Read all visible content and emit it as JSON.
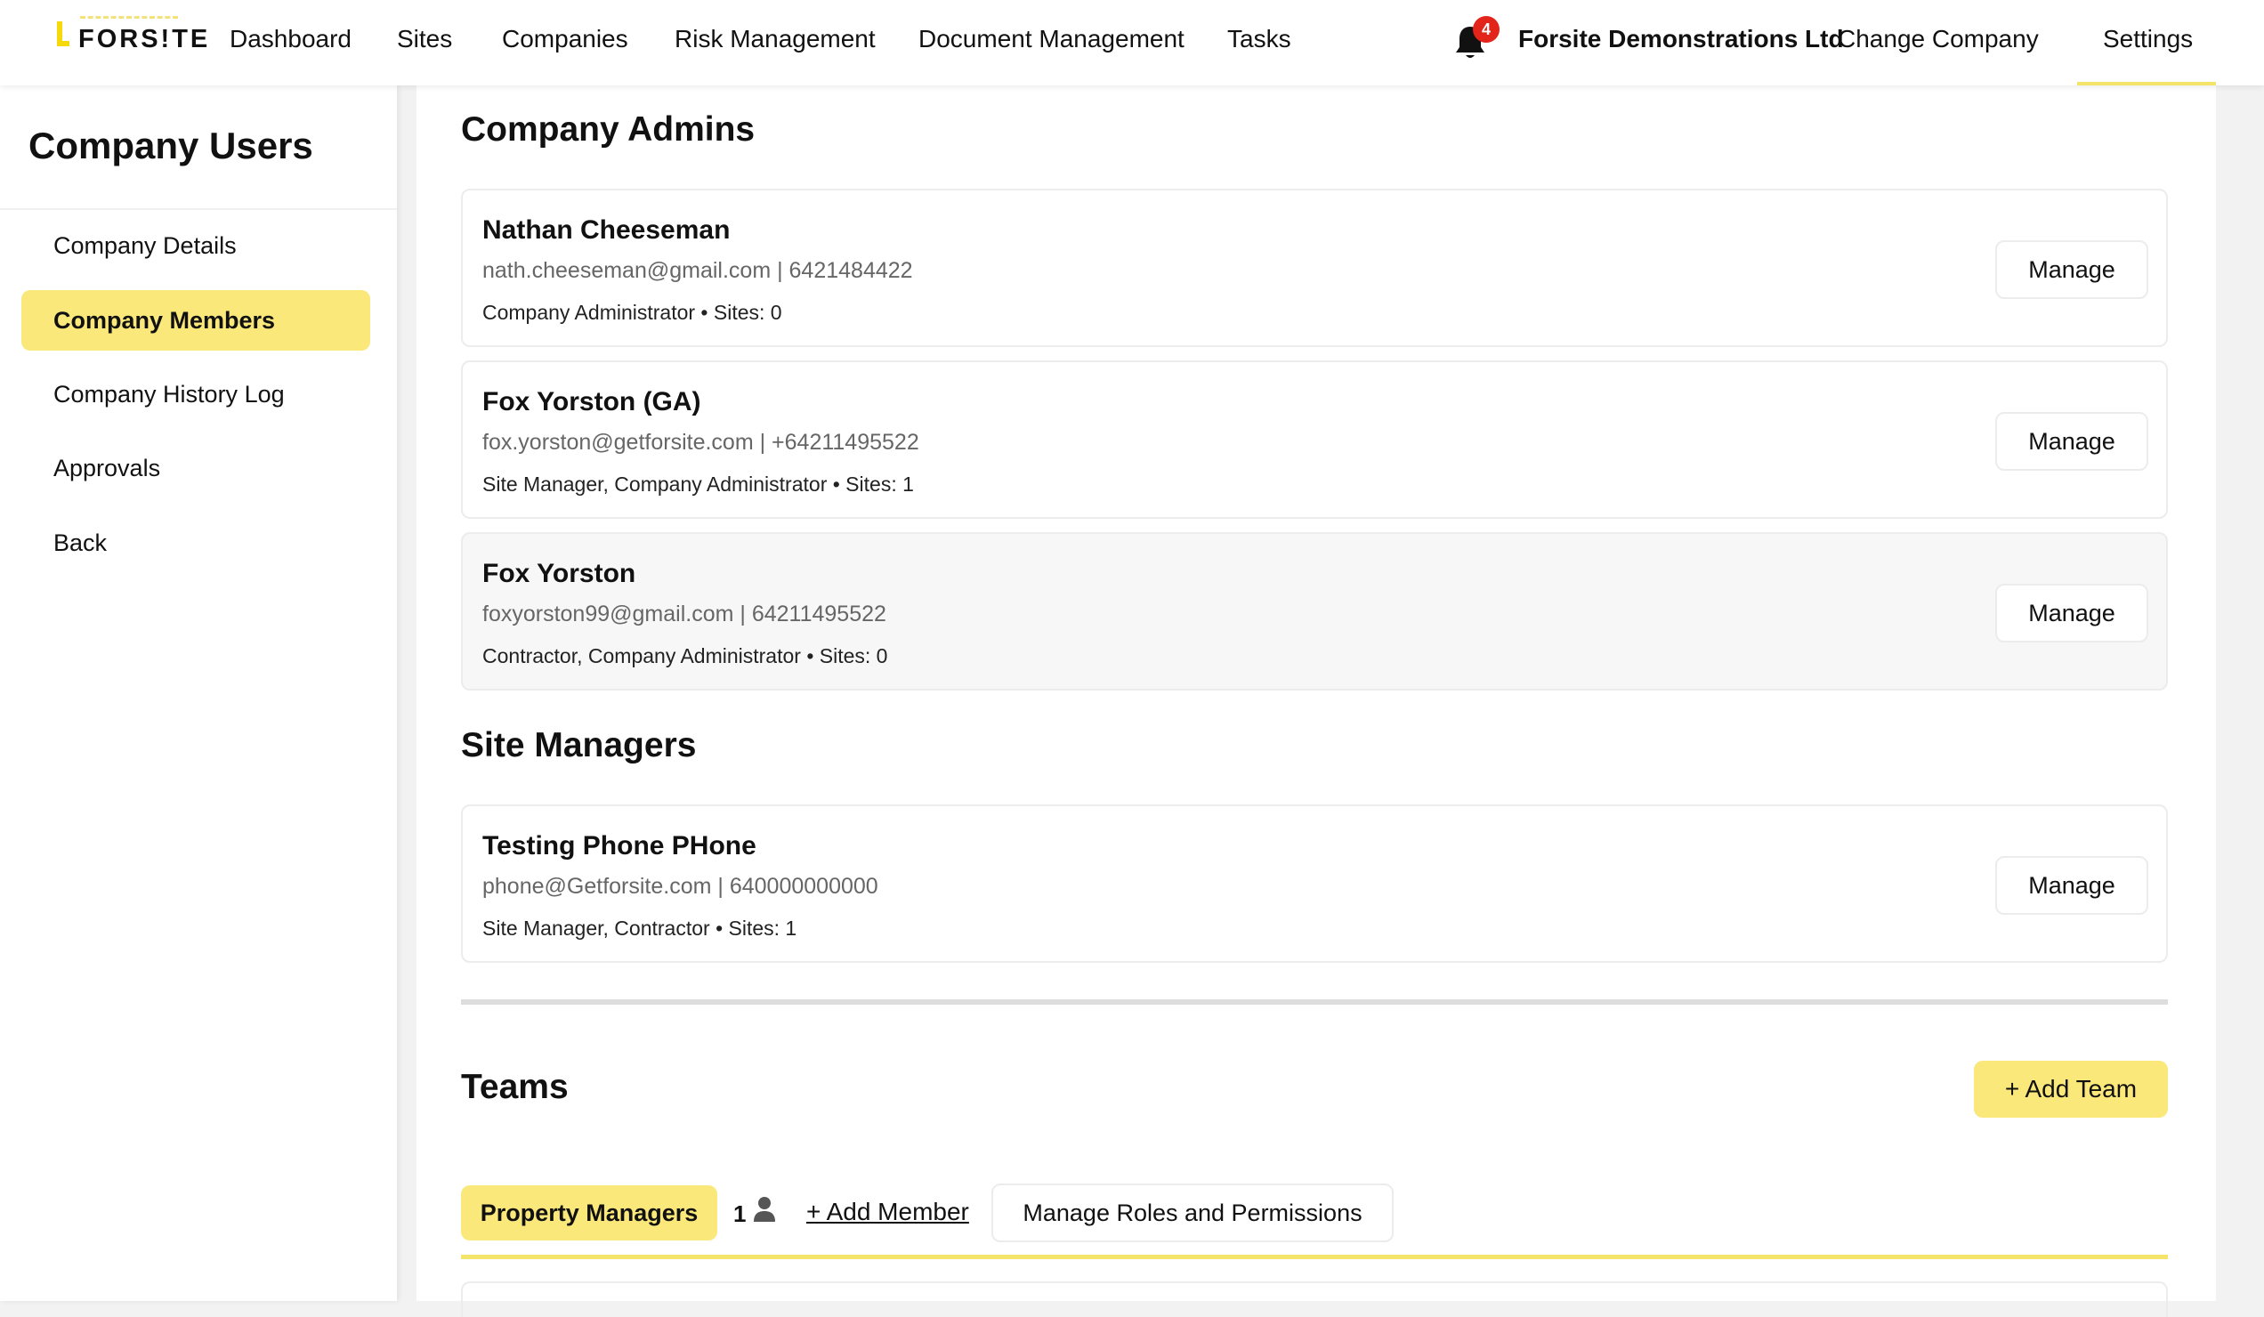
{
  "brand": {
    "logo_text": "FORS!TE",
    "accent_color": "#fbe87a",
    "badge_color": "#e3241b"
  },
  "nav": {
    "items": [
      "Dashboard",
      "Sites",
      "Companies",
      "Risk Management",
      "Document Management",
      "Tasks"
    ],
    "notifications_count": "4",
    "company_name": "Forsite Demonstrations Ltd",
    "change_company": "Change Company",
    "settings": "Settings"
  },
  "sidebar": {
    "title": "Company Users",
    "items": [
      {
        "label": "Company Details"
      },
      {
        "label": "Company Members"
      },
      {
        "label": "Company History Log"
      },
      {
        "label": "Approvals"
      },
      {
        "label": "Back"
      }
    ],
    "active": "Company Members"
  },
  "admins": {
    "title": "Company Admins",
    "members": [
      {
        "name": "Nathan Cheeseman",
        "contact": "nath.cheeseman@gmail.com | 6421484422",
        "roles": "Company Administrator • Sites: 0",
        "action": "Manage"
      },
      {
        "name": "Fox Yorston (GA)",
        "contact": "fox.yorston@getforsite.com | +64211495522",
        "roles": "Site Manager, Company Administrator • Sites: 1",
        "action": "Manage"
      },
      {
        "name": "Fox Yorston",
        "contact": "foxyorston99@gmail.com | 64211495522",
        "roles": "Contractor, Company Administrator • Sites: 0",
        "action": "Manage"
      }
    ]
  },
  "site_managers": {
    "title": "Site Managers",
    "members": [
      {
        "name": "Testing Phone PHone",
        "contact": "phone@Getforsite.com | 640000000000",
        "roles": "Site Manager, Contractor • Sites: 1",
        "action": "Manage"
      }
    ]
  },
  "teams": {
    "title": "Teams",
    "add_team": "+ Add Team",
    "active_team": "Property Managers",
    "member_count": "1",
    "add_member": "+ Add Member",
    "manage_roles": "Manage Roles and Permissions"
  }
}
